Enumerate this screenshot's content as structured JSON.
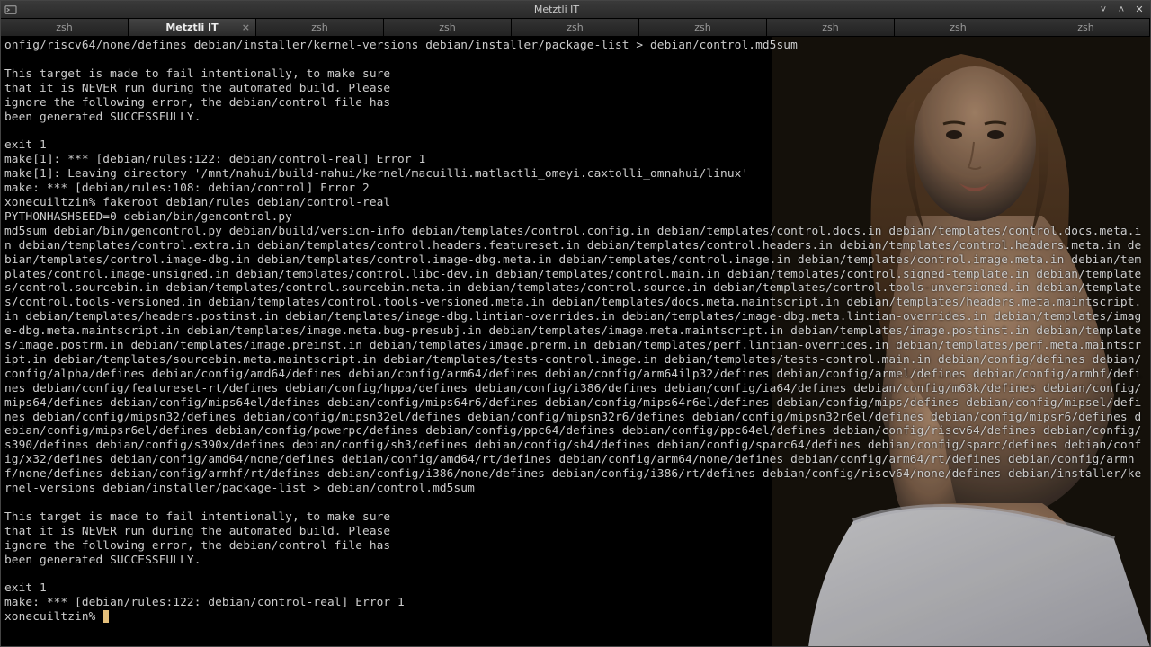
{
  "window": {
    "title": "Metztli IT"
  },
  "tabs": [
    {
      "label": "zsh",
      "active": false
    },
    {
      "label": "Metztli IT",
      "active": true,
      "closable": true
    },
    {
      "label": "zsh",
      "active": false
    },
    {
      "label": "zsh",
      "active": false
    },
    {
      "label": "zsh",
      "active": false
    },
    {
      "label": "zsh",
      "active": false
    },
    {
      "label": "zsh",
      "active": false
    },
    {
      "label": "zsh",
      "active": false
    },
    {
      "label": "zsh",
      "active": false
    }
  ],
  "terminal_lines": [
    "onfig/riscv64/none/defines debian/installer/kernel-versions debian/installer/package-list > debian/control.md5sum",
    "",
    "This target is made to fail intentionally, to make sure",
    "that it is NEVER run during the automated build. Please",
    "ignore the following error, the debian/control file has",
    "been generated SUCCESSFULLY.",
    "",
    "exit 1",
    "make[1]: *** [debian/rules:122: debian/control-real] Error 1",
    "make[1]: Leaving directory '/mnt/nahui/build-nahui/kernel/macuilli.matlactli_omeyi.caxtolli_omnahui/linux'",
    "make: *** [debian/rules:108: debian/control] Error 2",
    "xonecuiltzin% fakeroot debian/rules debian/control-real",
    "PYTHONHASHSEED=0 debian/bin/gencontrol.py",
    "md5sum debian/bin/gencontrol.py debian/build/version-info debian/templates/control.config.in debian/templates/control.docs.in debian/templates/control.docs.meta.in debian/templates/control.extra.in debian/templates/control.headers.featureset.in debian/templates/control.headers.in debian/templates/control.headers.meta.in debian/templates/control.image-dbg.in debian/templates/control.image-dbg.meta.in debian/templates/control.image.in debian/templates/control.image.meta.in debian/templates/control.image-unsigned.in debian/templates/control.libc-dev.in debian/templates/control.main.in debian/templates/control.signed-template.in debian/templates/control.sourcebin.in debian/templates/control.sourcebin.meta.in debian/templates/control.source.in debian/templates/control.tools-unversioned.in debian/templates/control.tools-versioned.in debian/templates/control.tools-versioned.meta.in debian/templates/docs.meta.maintscript.in debian/templates/headers.meta.maintscript.in debian/templates/headers.postinst.in debian/templates/image-dbg.lintian-overrides.in debian/templates/image-dbg.meta.lintian-overrides.in debian/templates/image-dbg.meta.maintscript.in debian/templates/image.meta.bug-presubj.in debian/templates/image.meta.maintscript.in debian/templates/image.postinst.in debian/templates/image.postrm.in debian/templates/image.preinst.in debian/templates/image.prerm.in debian/templates/perf.lintian-overrides.in debian/templates/perf.meta.maintscript.in debian/templates/sourcebin.meta.maintscript.in debian/templates/tests-control.image.in debian/templates/tests-control.main.in debian/config/defines debian/config/alpha/defines debian/config/amd64/defines debian/config/arm64/defines debian/config/arm64ilp32/defines debian/config/armel/defines debian/config/armhf/defines debian/config/featureset-rt/defines debian/config/hppa/defines debian/config/i386/defines debian/config/ia64/defines debian/config/m68k/defines debian/config/mips64/defines debian/config/mips64el/defines debian/config/mips64r6/defines debian/config/mips64r6el/defines debian/config/mips/defines debian/config/mipsel/defines debian/config/mipsn32/defines debian/config/mipsn32el/defines debian/config/mipsn32r6/defines debian/config/mipsn32r6el/defines debian/config/mipsr6/defines debian/config/mipsr6el/defines debian/config/powerpc/defines debian/config/ppc64/defines debian/config/ppc64el/defines debian/config/riscv64/defines debian/config/s390/defines debian/config/s390x/defines debian/config/sh3/defines debian/config/sh4/defines debian/config/sparc64/defines debian/config/sparc/defines debian/config/x32/defines debian/config/amd64/none/defines debian/config/amd64/rt/defines debian/config/arm64/none/defines debian/config/arm64/rt/defines debian/config/armhf/none/defines debian/config/armhf/rt/defines debian/config/i386/none/defines debian/config/i386/rt/defines debian/config/riscv64/none/defines debian/installer/kernel-versions debian/installer/package-list > debian/control.md5sum",
    "",
    "This target is made to fail intentionally, to make sure",
    "that it is NEVER run during the automated build. Please",
    "ignore the following error, the debian/control file has",
    "been generated SUCCESSFULLY.",
    "",
    "exit 1",
    "make: *** [debian/rules:122: debian/control-real] Error 1"
  ],
  "prompt": "xonecuiltzin% "
}
